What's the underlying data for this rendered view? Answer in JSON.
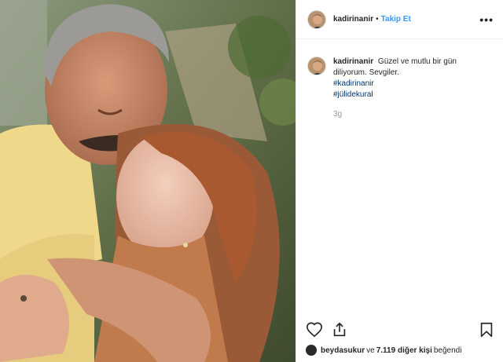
{
  "post": {
    "username": "kadirinanir",
    "separator": "•",
    "follow_label": "Takip Et",
    "more_label": "•••",
    "caption": {
      "username": "kadirinanir",
      "text": "Güzel ve mutlu bir gün diliyorum. Sevgiler.",
      "hashtags": [
        "#kadirinanir",
        "#jülidekural"
      ]
    },
    "time": "3g",
    "likes": {
      "liker": "beydasukur",
      "connector": "ve",
      "others": "7.119 diğer kişi",
      "suffix": "beğendi"
    }
  },
  "icons": {
    "like": "heart-icon",
    "share": "share-icon",
    "save": "bookmark-icon",
    "more": "more-options-icon"
  },
  "colors": {
    "follow": "#3897f0",
    "hashtag": "#003569",
    "muted": "#999999",
    "text": "#262626"
  }
}
